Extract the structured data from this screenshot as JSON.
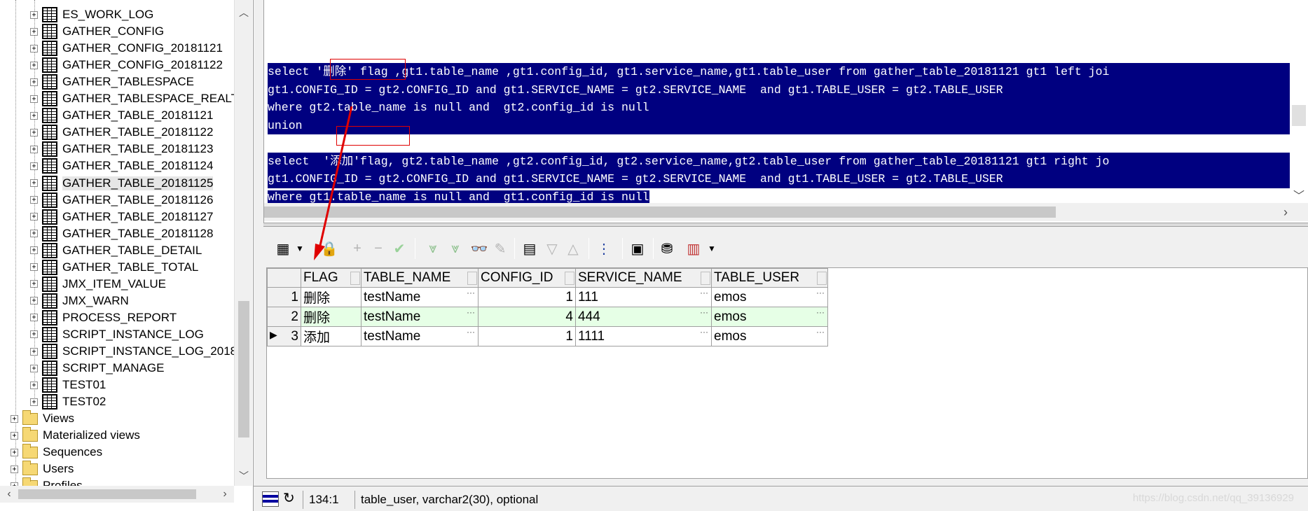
{
  "tree": {
    "tables": [
      "ES_WORK_LOG",
      "GATHER_CONFIG",
      "GATHER_CONFIG_20181121",
      "GATHER_CONFIG_20181122",
      "GATHER_TABLESPACE",
      "GATHER_TABLESPACE_REALT",
      "GATHER_TABLE_20181121",
      "GATHER_TABLE_20181122",
      "GATHER_TABLE_20181123",
      "GATHER_TABLE_20181124",
      "GATHER_TABLE_20181125",
      "GATHER_TABLE_20181126",
      "GATHER_TABLE_20181127",
      "GATHER_TABLE_20181128",
      "GATHER_TABLE_DETAIL",
      "GATHER_TABLE_TOTAL",
      "JMX_ITEM_VALUE",
      "JMX_WARN",
      "PROCESS_REPORT",
      "SCRIPT_INSTANCE_LOG",
      "SCRIPT_INSTANCE_LOG_2018",
      "SCRIPT_MANAGE",
      "TEST01",
      "TEST02"
    ],
    "folders": [
      "Views",
      "Materialized views",
      "Sequences",
      "Users",
      "Profiles"
    ],
    "expand_glyph": "+",
    "selected": "GATHER_TABLE_20181125"
  },
  "editor": {
    "lines": [
      "select '删除' flag ,gt1.table_name ,gt1.config_id, gt1.service_name,gt1.table_user from gather_table_20181121 gt1 left joi",
      "gt1.CONFIG_ID = gt2.CONFIG_ID and gt1.SERVICE_NAME = gt2.SERVICE_NAME  and gt1.TABLE_USER = gt2.TABLE_USER",
      "where gt2.table_name is null and  gt2.config_id is null",
      "union",
      "",
      "select  '添加'flag, gt2.table_name ,gt2.config_id, gt2.service_name,gt2.table_user from gather_table_20181121 gt1 right jo",
      "gt1.CONFIG_ID = gt2.CONFIG_ID and gt1.SERVICE_NAME = gt2.SERVICE_NAME  and gt1.TABLE_USER = gt2.TABLE_USER",
      "where gt1.table_name is null and  gt1.config_id is null"
    ],
    "selection_color": "#000080",
    "annotation_color": "#e00000"
  },
  "grid": {
    "columns": [
      "FLAG",
      "TABLE_NAME",
      "CONFIG_ID",
      "SERVICE_NAME",
      "TABLE_USER"
    ],
    "rows": [
      {
        "num": "1",
        "flag": "删除",
        "table_name": "testName",
        "config_id": "1",
        "service_name": "111",
        "table_user": "emos"
      },
      {
        "num": "2",
        "flag": "删除",
        "table_name": "testName",
        "config_id": "4",
        "service_name": "444",
        "table_user": "emos"
      },
      {
        "num": "3",
        "flag": "添加",
        "table_name": "testName",
        "config_id": "1",
        "service_name": "1111",
        "table_user": "emos"
      }
    ],
    "current_row_marker": "▶",
    "cell_button": "···",
    "alt_row_color": "#e6ffe6"
  },
  "status": {
    "position": "134:1",
    "field_info": "table_user, varchar2(30), optional",
    "watermark": "https://blog.csdn.net/qq_39136929"
  }
}
